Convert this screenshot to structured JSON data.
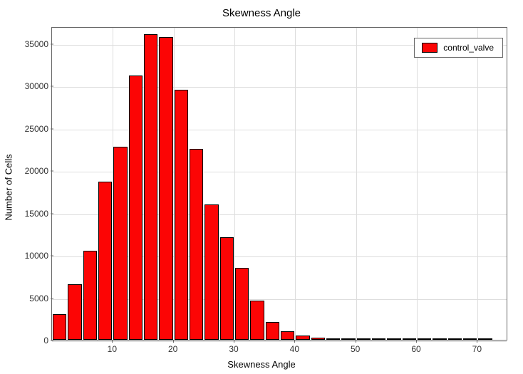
{
  "chart_data": {
    "type": "bar",
    "title": "Skewness Angle",
    "xlabel": "Skewness Angle",
    "ylabel": "Number of Cells",
    "x_ticks": [
      10,
      20,
      30,
      40,
      50,
      60,
      70
    ],
    "y_ticks": [
      0,
      5000,
      10000,
      15000,
      20000,
      25000,
      30000,
      35000
    ],
    "xlim": [
      0,
      75
    ],
    "ylim": [
      0,
      37000
    ],
    "bin_width": 2.5,
    "series": [
      {
        "name": "control_valve",
        "x": [
          1.25,
          3.75,
          6.25,
          8.75,
          11.25,
          13.75,
          16.25,
          18.75,
          21.25,
          23.75,
          26.25,
          28.75,
          31.25,
          33.75,
          36.25,
          38.75,
          41.25,
          43.75,
          46.25,
          48.75,
          51.25,
          53.75,
          56.25,
          58.75,
          61.25,
          63.75,
          66.25,
          68.75,
          71.25
        ],
        "values": [
          3050,
          6600,
          10500,
          18700,
          22800,
          31200,
          36100,
          35700,
          29500,
          22500,
          16000,
          12100,
          8500,
          4600,
          2100,
          1000,
          500,
          250,
          200,
          130,
          110,
          90,
          70,
          60,
          50,
          40,
          30,
          25,
          20
        ]
      }
    ],
    "legend": {
      "position": "top-right",
      "entries": [
        "control_valve"
      ]
    }
  },
  "colors": {
    "bar_fill": "#fc0505",
    "bar_stroke": "#000000"
  }
}
